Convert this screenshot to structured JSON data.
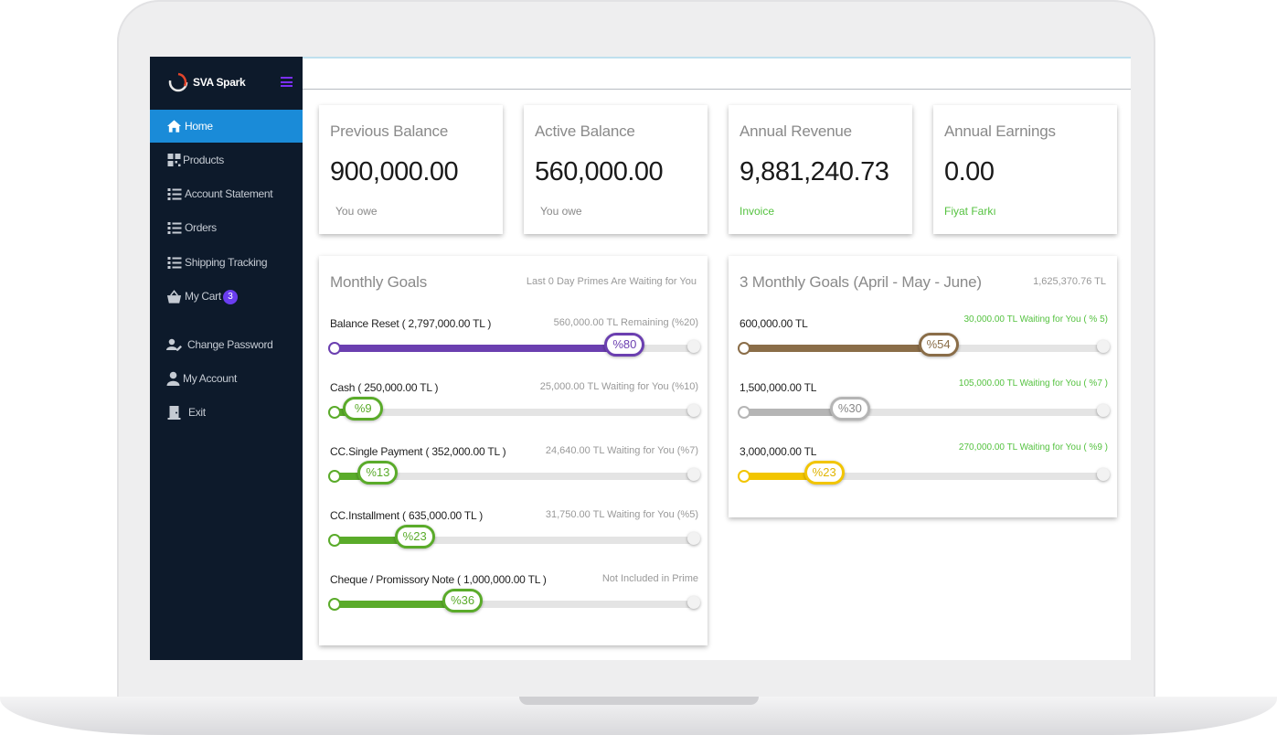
{
  "app": {
    "name": "SVA Spark"
  },
  "sidebar": {
    "items": [
      {
        "label": "Home",
        "icon": "home-icon",
        "active": true
      },
      {
        "label": "Products",
        "icon": "grid-icon"
      },
      {
        "label": "Account Statement",
        "icon": "list-icon"
      },
      {
        "label": "Orders",
        "icon": "list-icon"
      },
      {
        "label": "Shipping Tracking",
        "icon": "list-icon"
      },
      {
        "label": "My Cart",
        "icon": "basket-icon",
        "badge": "3"
      },
      {
        "label": "Change Password",
        "icon": "user-edit-icon"
      },
      {
        "label": "My Account",
        "icon": "user-icon"
      },
      {
        "label": "Exit",
        "icon": "door-icon"
      }
    ]
  },
  "stats": [
    {
      "title": "Previous Balance",
      "value": "900,000.00",
      "note": "You owe",
      "note_color": "#888888"
    },
    {
      "title": "Active Balance",
      "value": "560,000.00",
      "note": "You owe",
      "note_color": "#888888"
    },
    {
      "title": "Annual Revenue",
      "value": "9,881,240.73",
      "note": "Invoice",
      "note_color": "#55c240"
    },
    {
      "title": "Annual Earnings",
      "value": "0.00",
      "note": "Fiyat Farkı",
      "note_color": "#55c240"
    }
  ],
  "monthly_goals": {
    "title": "Monthly Goals",
    "subtitle": "Last 0 Day Primes Are Waiting for You",
    "items": [
      {
        "label": "Balance Reset ( 2,797,000.00 TL )",
        "remaining": "560,000.00 TL Remaining (%20)",
        "percent": 80,
        "percent_label": "%80",
        "color": "#6b3fb0"
      },
      {
        "label": "Cash ( 250,000.00 TL )",
        "remaining": "25,000.00 TL Waiting for You (%10)",
        "percent": 9,
        "percent_label": "%9",
        "color": "#5aab2a"
      },
      {
        "label": "CC.Single Payment ( 352,000.00 TL )",
        "remaining": "24,640.00 TL Waiting for You (%7)",
        "percent": 13,
        "percent_label": "%13",
        "color": "#5aab2a"
      },
      {
        "label": "CC.Installment ( 635,000.00 TL )",
        "remaining": "31,750.00 TL Waiting for You (%5)",
        "percent": 23,
        "percent_label": "%23",
        "color": "#5aab2a"
      },
      {
        "label": "Cheque / Promissory Note ( 1,000,000.00 TL )",
        "remaining": "Not Included in Prime",
        "percent": 36,
        "percent_label": "%36",
        "color": "#5aab2a"
      }
    ]
  },
  "quarter_goals": {
    "title": "3 Monthly Goals (April - May - June)",
    "total": "1,625,370.76 TL",
    "items": [
      {
        "label": "600,000.00 TL",
        "remaining": "30,000.00 TL Waiting for You ( % 5)",
        "percent": 54,
        "percent_label": "%54",
        "color": "#8a6d48"
      },
      {
        "label": "1,500,000.00 TL",
        "remaining": "105,000.00 TL Waiting for You ( %7 )",
        "percent": 30,
        "percent_label": "%30",
        "color": "#b5b5b5"
      },
      {
        "label": "3,000,000.00 TL",
        "remaining": "270,000.00 TL Waiting for You ( %9 )",
        "percent": 23,
        "percent_label": "%23",
        "color": "#f2c500"
      }
    ]
  }
}
